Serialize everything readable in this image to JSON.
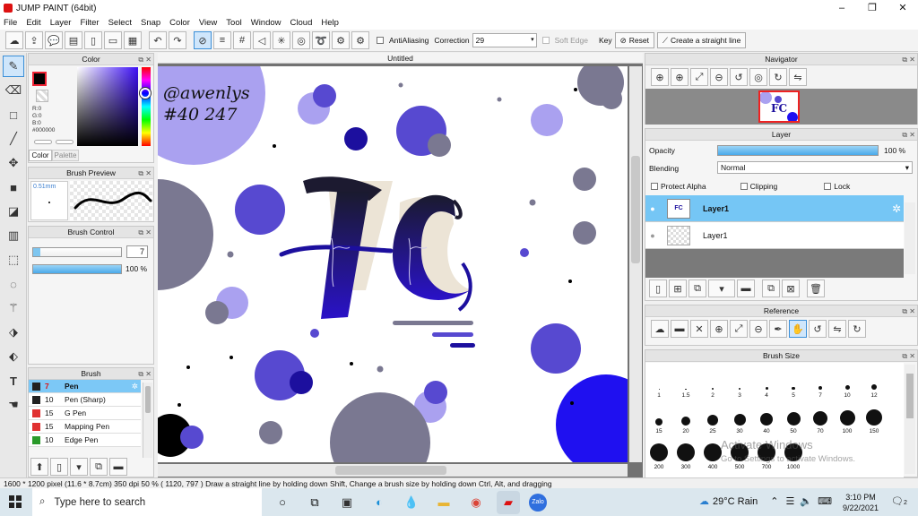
{
  "window": {
    "title": "JUMP PAINT (64bit)",
    "minimize": "–",
    "maximize": "❐",
    "close": "✕"
  },
  "menu": [
    "File",
    "Edit",
    "Layer",
    "Filter",
    "Select",
    "Snap",
    "Color",
    "View",
    "Tool",
    "Window",
    "Cloud",
    "Help"
  ],
  "toolbar": {
    "antialiasing": "AntiAliasing",
    "correction_label": "Correction",
    "correction_value": "29",
    "soft_edge": "Soft Edge",
    "key": "Key",
    "reset": "Reset",
    "straight_line": "Create a straight line"
  },
  "color_panel": {
    "title": "Color",
    "r": "R:0",
    "g": "G:0",
    "b": "B:0",
    "hex": "#000000",
    "tab_color": "Color",
    "tab_palette": "Palette",
    "primary": "#000000",
    "secondary": "#ffffff"
  },
  "brush_preview": {
    "title": "Brush Preview",
    "size": "0.51mm"
  },
  "brush_control": {
    "title": "Brush Control",
    "size_value": "7",
    "opacity_value": "100 %",
    "opacity_fraction": 1.0
  },
  "brush_panel": {
    "title": "Brush",
    "items": [
      {
        "num": "7",
        "name": "Pen",
        "color": "#222222",
        "selected": true
      },
      {
        "num": "10",
        "name": "Pen (Sharp)",
        "color": "#222222"
      },
      {
        "num": "15",
        "name": "G Pen",
        "color": "#e03030"
      },
      {
        "num": "15",
        "name": "Mapping Pen",
        "color": "#e03030"
      },
      {
        "num": "10",
        "name": "Edge Pen",
        "color": "#2a9a2a"
      }
    ]
  },
  "canvas": {
    "tab_title": "Untitled",
    "signature_line1": "@awenlys",
    "signature_line2": "#40 247",
    "colors": {
      "lavender": "#aaa1f0",
      "indigo": "#5749d0",
      "navy": "#1c0f9e",
      "gray": "#7a7891",
      "blue": "#1f10f0"
    }
  },
  "navigator": {
    "title": "Navigator"
  },
  "layer_panel": {
    "title": "Layer",
    "opacity_label": "Opacity",
    "opacity_value": "100 %",
    "blending_label": "Blending",
    "blending_value": "Normal",
    "protect_alpha": "Protect Alpha",
    "clipping": "Clipping",
    "lock": "Lock",
    "layers": [
      {
        "name": "Layer1",
        "selected": true
      },
      {
        "name": "Layer1",
        "selected": false
      }
    ]
  },
  "reference": {
    "title": "Reference"
  },
  "brush_size": {
    "title": "Brush Size",
    "sizes": [
      "1",
      "1.5",
      "2",
      "3",
      "4",
      "5",
      "7",
      "10",
      "12",
      "15",
      "20",
      "25",
      "30",
      "40",
      "50",
      "70",
      "100",
      "150",
      "200",
      "300",
      "400",
      "500",
      "700",
      "1000"
    ]
  },
  "watermark": {
    "line1": "Activate Windows",
    "line2": "Go to Settings to activate Windows."
  },
  "status": {
    "text": "1600 * 1200 pixel  (11.6 * 8.7cm)  350 dpi  50 %  ( 1120, 797 )  Draw a straight line by holding down Shift, Change a brush size by holding down Ctrl, Alt, and dragging"
  },
  "taskbar": {
    "search_placeholder": "Type here to search",
    "weather": "29°C  Rain",
    "time": "3:10 PM",
    "date": "9/22/2021",
    "notif_count": "2"
  }
}
